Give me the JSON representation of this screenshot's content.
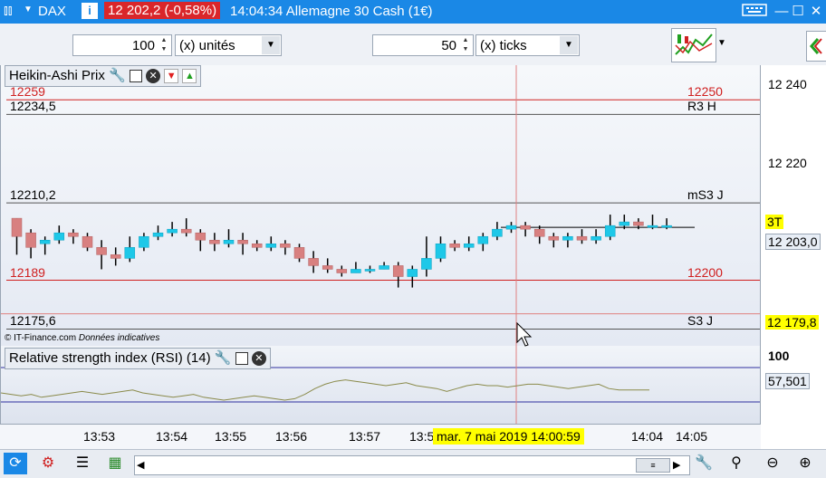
{
  "titlebar": {
    "symbol": "DAX",
    "price_change": "12 202,2 (-0,58%)",
    "time_name": "14:04:34 Allemagne 30 Cash (1€)",
    "info_icon": "i",
    "colors": {
      "bar": "#1a88e6",
      "badge": "#d9262a"
    }
  },
  "toolbar": {
    "units_value": "100",
    "units_label": "(x) unités",
    "ticks_value": "50",
    "ticks_label": "(x) ticks"
  },
  "price_panel": {
    "title": "Heikin-Ashi Prix",
    "levels": [
      {
        "left": "12259",
        "right": "12250",
        "price": 12238.5,
        "color": "#d02020"
      },
      {
        "left": "12234,5",
        "right": "R3 H",
        "price": 12234.5,
        "color": "#555555"
      },
      {
        "left": "12210,2",
        "right": "mS3 J",
        "price": 12210.2,
        "color": "#555555"
      },
      {
        "left": "12189",
        "right": "12200",
        "price": 12189,
        "color": "#d02020"
      },
      {
        "left": "12175,6",
        "right": "S3 J",
        "price": 12175.6,
        "color": "#555555"
      }
    ],
    "copyright": "© IT-Finance.com",
    "copyright_note": "Données indicatives"
  },
  "price_axis": {
    "ticks": [
      "12 240",
      "12 220"
    ],
    "current_price": "12 203,0",
    "crosshair_price": "12 179,8",
    "marker": "3T"
  },
  "rsi_panel": {
    "title": "Relative strength index (RSI) (14)",
    "top_label": "100",
    "current": "57,501"
  },
  "time_axis": {
    "labels": [
      "13:53",
      "13:54",
      "13:55",
      "13:56",
      "13:57",
      "13:5",
      "14:04",
      "14:05"
    ],
    "crosshair_label": "mar. 7 mai 2019 14:00:59"
  },
  "chart_data": {
    "type": "candlestick",
    "price_range": [
      12171,
      12248
    ],
    "candles": [
      {
        "o": 12206,
        "c": 12201,
        "h": 12206,
        "l": 12196
      },
      {
        "o": 12202,
        "c": 12198,
        "h": 12203,
        "l": 12195
      },
      {
        "o": 12199,
        "c": 12200,
        "h": 12201,
        "l": 12196
      },
      {
        "o": 12200,
        "c": 12202,
        "h": 12204,
        "l": 12199
      },
      {
        "o": 12202,
        "c": 12201,
        "h": 12203,
        "l": 12199
      },
      {
        "o": 12201,
        "c": 12198,
        "h": 12202,
        "l": 12197
      },
      {
        "o": 12198,
        "c": 12196,
        "h": 12200,
        "l": 12192
      },
      {
        "o": 12196,
        "c": 12195,
        "h": 12198,
        "l": 12193
      },
      {
        "o": 12195,
        "c": 12198,
        "h": 12201,
        "l": 12194
      },
      {
        "o": 12198,
        "c": 12201,
        "h": 12202,
        "l": 12197
      },
      {
        "o": 12201,
        "c": 12202,
        "h": 12204,
        "l": 12200
      },
      {
        "o": 12202,
        "c": 12203,
        "h": 12205,
        "l": 12201
      },
      {
        "o": 12203,
        "c": 12202,
        "h": 12206,
        "l": 12201
      },
      {
        "o": 12202,
        "c": 12200,
        "h": 12203,
        "l": 12197
      },
      {
        "o": 12200,
        "c": 12199,
        "h": 12202,
        "l": 12197
      },
      {
        "o": 12199,
        "c": 12200,
        "h": 12203,
        "l": 12198
      },
      {
        "o": 12200,
        "c": 12199,
        "h": 12202,
        "l": 12196
      },
      {
        "o": 12199,
        "c": 12198,
        "h": 12200,
        "l": 12197
      },
      {
        "o": 12198,
        "c": 12199,
        "h": 12201,
        "l": 12197
      },
      {
        "o": 12199,
        "c": 12198,
        "h": 12200,
        "l": 12196
      },
      {
        "o": 12198,
        "c": 12195,
        "h": 12199,
        "l": 12194
      },
      {
        "o": 12195,
        "c": 12193,
        "h": 12197,
        "l": 12191
      },
      {
        "o": 12193,
        "c": 12192,
        "h": 12195,
        "l": 12191
      },
      {
        "o": 12192,
        "c": 12191,
        "h": 12193,
        "l": 12190
      },
      {
        "o": 12191,
        "c": 12192,
        "h": 12194,
        "l": 12191
      },
      {
        "o": 12192,
        "c": 12192,
        "h": 12193,
        "l": 12191
      },
      {
        "o": 12192,
        "c": 12193,
        "h": 12194,
        "l": 12192
      },
      {
        "o": 12193,
        "c": 12190,
        "h": 12194,
        "l": 12187
      },
      {
        "o": 12190,
        "c": 12192,
        "h": 12193,
        "l": 12187
      },
      {
        "o": 12192,
        "c": 12195,
        "h": 12201,
        "l": 12190
      },
      {
        "o": 12195,
        "c": 12199,
        "h": 12201,
        "l": 12194
      },
      {
        "o": 12199,
        "c": 12198,
        "h": 12200,
        "l": 12197
      },
      {
        "o": 12198,
        "c": 12199,
        "h": 12201,
        "l": 12197
      },
      {
        "o": 12199,
        "c": 12201,
        "h": 12202,
        "l": 12197
      },
      {
        "o": 12201,
        "c": 12203,
        "h": 12205,
        "l": 12200
      },
      {
        "o": 12203,
        "c": 12204,
        "h": 12205,
        "l": 12202
      },
      {
        "o": 12204,
        "c": 12203,
        "h": 12205,
        "l": 12201
      },
      {
        "o": 12203,
        "c": 12201,
        "h": 12204,
        "l": 12199
      },
      {
        "o": 12201,
        "c": 12200,
        "h": 12202,
        "l": 12198
      },
      {
        "o": 12200,
        "c": 12201,
        "h": 12202,
        "l": 12198
      },
      {
        "o": 12201,
        "c": 12200,
        "h": 12203,
        "l": 12199
      },
      {
        "o": 12200,
        "c": 12201,
        "h": 12203,
        "l": 12199
      },
      {
        "o": 12201,
        "c": 12204,
        "h": 12207,
        "l": 12200
      },
      {
        "o": 12204,
        "c": 12205,
        "h": 12207,
        "l": 12203
      },
      {
        "o": 12205,
        "c": 12204,
        "h": 12206,
        "l": 12203
      },
      {
        "o": 12204,
        "c": 12204,
        "h": 12207,
        "l": 12203
      },
      {
        "o": 12204,
        "c": 12204,
        "h": 12206,
        "l": 12203
      }
    ],
    "rsi_range": [
      0,
      100
    ],
    "rsi": [
      55,
      54,
      53,
      54,
      52,
      53,
      54,
      55,
      56,
      55,
      54,
      55,
      56,
      57,
      55,
      54,
      53,
      52,
      53,
      54,
      52,
      51,
      50,
      51,
      52,
      53,
      52,
      51,
      50,
      51,
      54,
      58,
      61,
      63,
      64,
      63,
      62,
      61,
      60,
      61,
      62,
      60,
      59,
      58,
      56,
      58,
      60,
      61,
      60,
      60,
      59,
      60,
      61,
      61,
      60,
      59,
      58,
      59,
      60,
      61,
      58,
      57,
      57,
      57,
      57
    ]
  }
}
